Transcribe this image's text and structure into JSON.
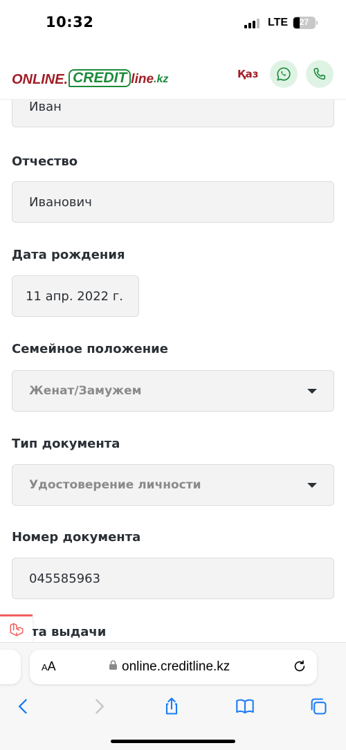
{
  "status_bar": {
    "time": "10:32",
    "network": "LTE",
    "battery": "27"
  },
  "header": {
    "logo": {
      "part1": "ONLINE.",
      "part2": "CREDIT",
      "part3": "line",
      "part4": ".kz"
    },
    "lang_label": "Қаз"
  },
  "form": {
    "first_name": {
      "value": "Иван"
    },
    "patronymic": {
      "label": "Отчество",
      "value": "Иванович"
    },
    "birth_date": {
      "label": "Дата рождения",
      "value": "11 апр. 2022 г."
    },
    "marital_status": {
      "label": "Семейное положение",
      "value": "Женат/Замужем"
    },
    "document_type": {
      "label": "Тип документа",
      "value": "Удостоверение личности"
    },
    "document_number": {
      "label": "Номер документа",
      "value": "045585963"
    },
    "issue_date": {
      "label": "Дата выдачи"
    }
  },
  "browser": {
    "aa_small": "A",
    "aa_large": "A",
    "url": "online.creditline.kz"
  },
  "colors": {
    "brand_red": "#a01d26",
    "brand_green": "#1c8b3a",
    "ios_blue": "#1a7cf5"
  }
}
